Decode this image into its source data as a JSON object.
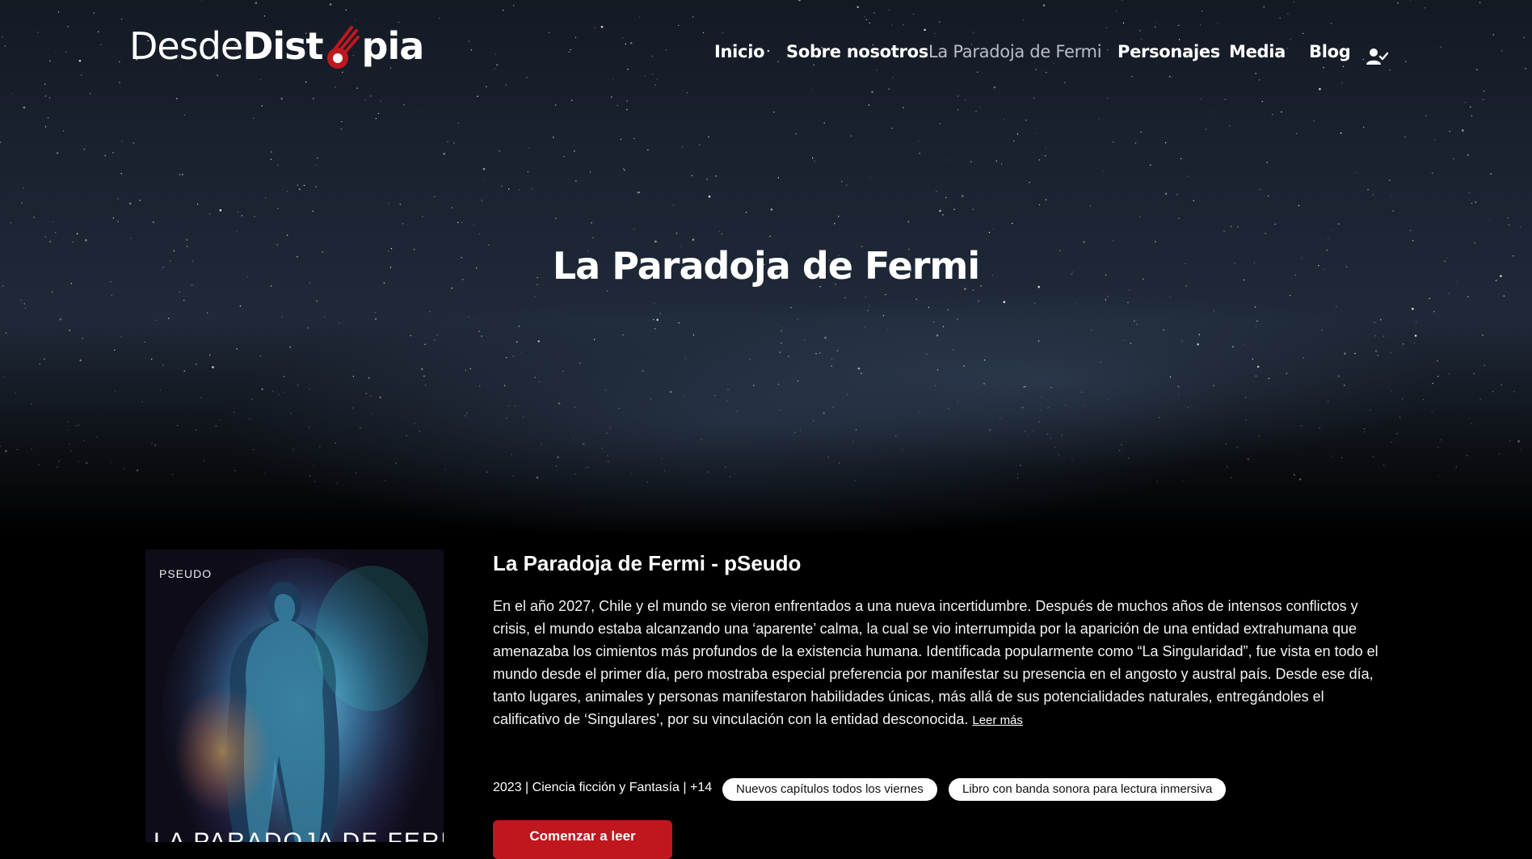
{
  "colors": {
    "accent_red": "#c0171f",
    "nav_active": "#b9bec6",
    "background": "#000000"
  },
  "header": {
    "logo": {
      "part1": "Desde",
      "part2": "Dist",
      "part3": "pia"
    },
    "nav": [
      {
        "label": "Inicio"
      },
      {
        "label": "Sobre nosotros"
      },
      {
        "label": "La Paradoja de Fermi"
      },
      {
        "label": "Personajes"
      },
      {
        "label": "Media"
      },
      {
        "label": "Blog"
      }
    ],
    "user_icon": "user-check-icon"
  },
  "hero": {
    "title": "La Paradoja de Fermi"
  },
  "book": {
    "cover": {
      "brand": "PSEUDO",
      "title": "LA PARADOJA DE FERMI"
    },
    "title": "La Paradoja de Fermi - pSeudo",
    "synopsis": "En el año 2027, Chile y el mundo se vieron enfrentados a una nueva incertidumbre. Después de muchos años de intensos conflictos y crisis, el mundo estaba alcanzando una ‘aparente’ calma, la cual se vio interrumpida por la aparición de una entidad extrahumana que amenazaba los cimientos más profundos de la existencia humana. Identificada popularmente como “La Singularidad”, fue vista en todo el mundo desde el primer día, pero mostraba especial preferencia por manifestar su presencia en el angosto y austral país. Desde ese día, tanto lugares, animales y personas manifestaron habilidades únicas, más allá de sus potencialidades naturales, entregándoles el calificativo de ‘Singulares’, por su vinculación con la entidad desconocida.",
    "read_more": "Leer más",
    "meta": "2023 | Ciencia ficción y Fantasía | +14",
    "tags": [
      "Nuevos capítulos todos los viernes",
      "Libro con banda sonora para lectura inmersiva"
    ],
    "cta": "Comenzar a leer"
  }
}
